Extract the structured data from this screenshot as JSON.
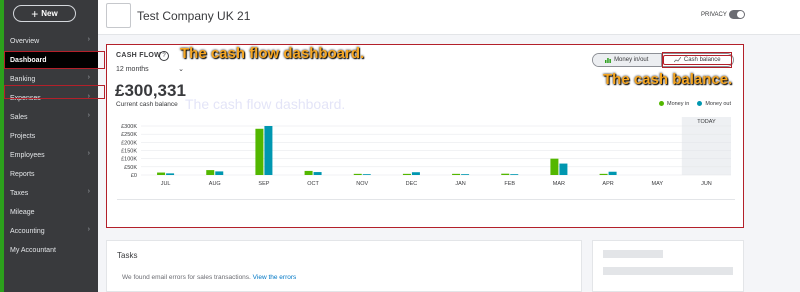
{
  "sidebar": {
    "new_label": "New",
    "items": [
      {
        "label": "Overview",
        "chevron": true
      },
      {
        "label": "Dashboard",
        "chevron": false,
        "active": true
      },
      {
        "label": "Banking",
        "chevron": true
      },
      {
        "label": "Expenses",
        "chevron": true
      },
      {
        "label": "Sales",
        "chevron": true
      },
      {
        "label": "Projects",
        "chevron": false
      },
      {
        "label": "Employees",
        "chevron": true
      },
      {
        "label": "Reports",
        "chevron": false
      },
      {
        "label": "Taxes",
        "chevron": true
      },
      {
        "label": "Mileage",
        "chevron": false
      },
      {
        "label": "Accounting",
        "chevron": true
      },
      {
        "label": "My Accountant",
        "chevron": false
      }
    ]
  },
  "header": {
    "company_name": "Test Company UK 21",
    "privacy_label": "PRIVACY"
  },
  "cashflow": {
    "title": "CASH FLOW",
    "period": "12 months",
    "amount": "£300,331",
    "amount_label": "Current cash balance",
    "toggle_money": "Money in/out",
    "toggle_balance": "Cash balance",
    "legend_in": "Money in",
    "legend_out": "Money out",
    "today_label": "TODAY"
  },
  "annotations": {
    "dashboard": "The cash flow dashboard.",
    "balance": "The cash balance.",
    "ghost": "The cash flow dashboard."
  },
  "tasks": {
    "title": "Tasks",
    "message": "We found email errors for sales transactions.",
    "link": "View the errors"
  },
  "colors": {
    "money_in": "#53b700",
    "money_out": "#0097b0",
    "sidebar_bg": "#393a3d",
    "accent_green": "#2ca01c",
    "highlight_red": "#b3202a",
    "annotation_orange": "#f5a623"
  },
  "chart_data": {
    "type": "bar",
    "categories": [
      "JUL",
      "AUG",
      "SEP",
      "OCT",
      "NOV",
      "DEC",
      "JAN",
      "FEB",
      "MAR",
      "APR",
      "MAY",
      "JUN"
    ],
    "series": [
      {
        "name": "Money in",
        "values": [
          15000,
          30000,
          283000,
          25000,
          7000,
          7000,
          7000,
          8000,
          100000,
          7000,
          0,
          0
        ]
      },
      {
        "name": "Money out",
        "values": [
          10000,
          22000,
          300000,
          18000,
          5000,
          17000,
          5000,
          5000,
          70000,
          20000,
          0,
          0
        ]
      }
    ],
    "yticks": [
      "£300K",
      "£250K",
      "£200K",
      "£150K",
      "£100K",
      "£50K",
      "£0"
    ],
    "ylim": [
      0,
      300000
    ],
    "highlight_label": "TODAY",
    "grid": true
  }
}
